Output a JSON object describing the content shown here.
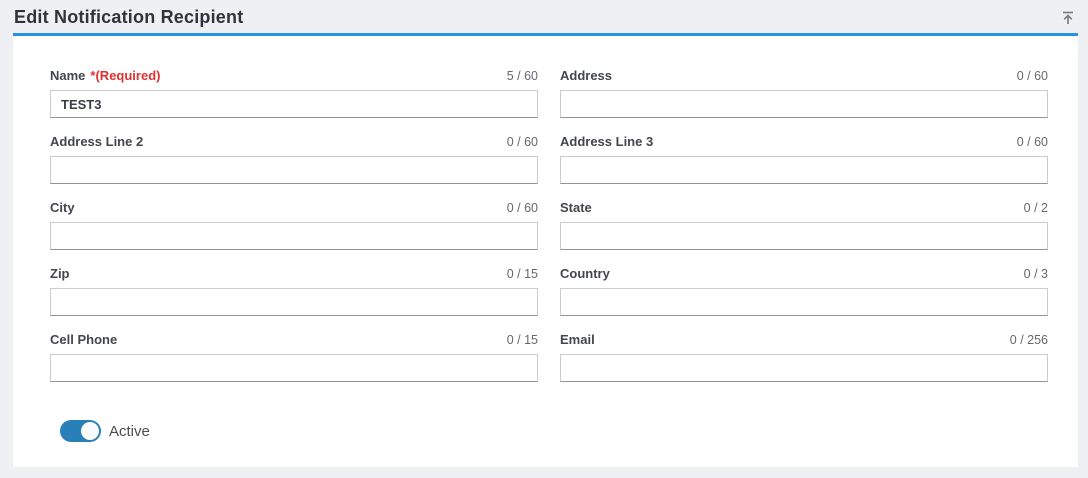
{
  "page": {
    "title": "Edit Notification Recipient"
  },
  "header": {
    "collapse_icon": "collapse-up-icon"
  },
  "colors": {
    "page_background": "#eff0f3",
    "card_accent_line": "#2b91e8",
    "required_red": "#e03131",
    "toggle_on_blue": "#2980b9",
    "label_text": "#43464c",
    "counter_text": "#65686d"
  },
  "form": {
    "fields": [
      {
        "id": "name",
        "label": "Name",
        "required_note": "*(Required)",
        "counter": "5 / 60",
        "value": "TEST3"
      },
      {
        "id": "address",
        "label": "Address",
        "required_note": "",
        "counter": "0 / 60",
        "value": ""
      },
      {
        "id": "address-line-2",
        "label": "Address Line 2",
        "required_note": "",
        "counter": "0 / 60",
        "value": ""
      },
      {
        "id": "address-line-3",
        "label": "Address Line 3",
        "required_note": "",
        "counter": "0 / 60",
        "value": ""
      },
      {
        "id": "city",
        "label": "City",
        "required_note": "",
        "counter": "0 / 60",
        "value": ""
      },
      {
        "id": "state",
        "label": "State",
        "required_note": "",
        "counter": "0 / 2",
        "value": ""
      },
      {
        "id": "zip",
        "label": "Zip",
        "required_note": "",
        "counter": "0 / 15",
        "value": ""
      },
      {
        "id": "country",
        "label": "Country",
        "required_note": "",
        "counter": "0 / 3",
        "value": ""
      },
      {
        "id": "cell-phone",
        "label": "Cell Phone",
        "required_note": "",
        "counter": "0 / 15",
        "value": ""
      },
      {
        "id": "email",
        "label": "Email",
        "required_note": "",
        "counter": "0 / 256",
        "value": ""
      }
    ],
    "toggle": {
      "label": "Active",
      "state": "on"
    }
  }
}
